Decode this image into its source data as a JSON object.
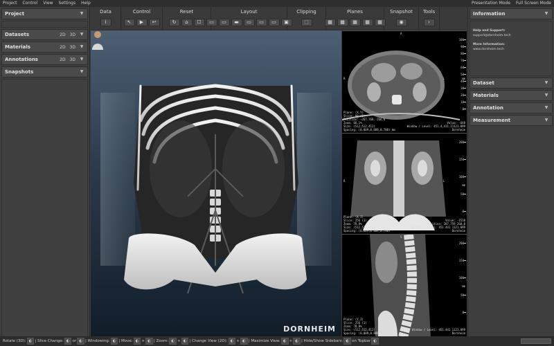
{
  "menu": {
    "items": [
      "Project",
      "Control",
      "View",
      "Settings",
      "Help"
    ],
    "right": [
      "Presentation Mode",
      "Full Screen Mode"
    ]
  },
  "left": {
    "sections": [
      {
        "label": "Project",
        "tags": []
      },
      {
        "label": "Datasets",
        "tags": [
          "2D",
          "3D"
        ]
      },
      {
        "label": "Materials",
        "tags": [
          "2D",
          "3D"
        ]
      },
      {
        "label": "Annotations",
        "tags": [
          "2D",
          "3D"
        ]
      },
      {
        "label": "Snapshots",
        "tags": []
      }
    ]
  },
  "toolbar": {
    "groups": [
      {
        "title": "Data",
        "buttons": [
          "i"
        ]
      },
      {
        "title": "Control",
        "buttons": [
          "↖",
          "▶",
          "↩"
        ]
      },
      {
        "title": "Reset",
        "buttons": [
          "↻",
          "⌂",
          "☐"
        ]
      },
      {
        "title": "Layout",
        "buttons": [
          "▭",
          "▭",
          "▬",
          "▭",
          "▭",
          "▭",
          "▣"
        ]
      },
      {
        "title": "Clipping",
        "buttons": [
          "⬚"
        ]
      },
      {
        "title": "Planes",
        "buttons": [
          "▦",
          "▦",
          "▦",
          "▦",
          "▦"
        ]
      },
      {
        "title": "Snapshot",
        "buttons": [
          "◉"
        ]
      },
      {
        "title": "Tools",
        "buttons": [
          "›"
        ]
      }
    ]
  },
  "viewer": {
    "logo": "DORNHEIM"
  },
  "slices": [
    {
      "top_label": "A",
      "left_label": "R",
      "right_label": "L",
      "ticks": [
        "100",
        "90",
        "80",
        "70",
        "60",
        "50",
        "40",
        "30",
        "20",
        "10",
        "0"
      ],
      "unit": "mm",
      "bl_text": "Plane: (X,Y)\nSlice: 98 (1)\nPosition: -267.768.-266.6\nZoom: 66.1%\nSize: (512,512,412)\nSpacing: (0.809,0.809,0.780) mm",
      "br_text": "Value: -648\nWindow / Level: 451.4,411.11121.099\nDornheim"
    },
    {
      "top_label": "",
      "left_label": "R",
      "right_label": "L",
      "ticks": [
        "200",
        "150",
        "100",
        "50",
        "0"
      ],
      "unit": "mm",
      "bl_text": "Plane: (X,Z)\nSlice: 256 (1)\nZoom: 78.8%\nSize: (512,512,412)\nSpacing: (0.809,0.809,0.780)",
      "br_text": "Value: -1518\nPosition: 287.759 260.0\nWindow / Level: 451.441 1121.099\nDornheim"
    },
    {
      "top_label": "S",
      "left_label": "",
      "right_label": "",
      "ticks": [
        "200",
        "150",
        "100",
        "50",
        "0"
      ],
      "unit": "mm",
      "bl_text": "Plane: (Y,Z)\nSlice: 256 (1)\nZoom: 78.8%\nSize: (512,512,412)\nSpacing: (0.809,0.809,0.780)",
      "br_text": "Window / Level: 451.441 1121.099\nDornheim"
    }
  ],
  "right": {
    "info_title": "Information",
    "help_title": "Help and Support:",
    "help_value": "support@dornheim.tech",
    "more_title": "More Information:",
    "more_value": "www.dornheim.tech",
    "sections": [
      "Dataset",
      "Materials",
      "Annotation",
      "Measurement"
    ]
  },
  "status": {
    "parts": [
      "Rotate (3D):",
      "| Slice Change:",
      "or",
      "| Windowing:",
      "| Move:",
      "+",
      "| Zoom:",
      "+",
      "| Change View (2D):",
      "+",
      "| Maximize View:",
      "+",
      "| Hide/Show Sidebars:",
      "on Topbar"
    ]
  }
}
